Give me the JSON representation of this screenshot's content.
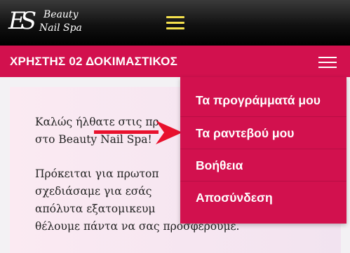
{
  "header": {
    "logo": {
      "mark": "ES",
      "line1": "Beauty",
      "line2": "Nail Spa"
    },
    "menu_icon": "hamburger-icon",
    "menu_icon_color": "#f4e04d"
  },
  "user_bar": {
    "username": "ΧΡΗΣΤΗΣ 02 ΔΟΚΙΜΑΣΤΙΚΟΣ",
    "menu_icon": "hamburger-icon",
    "color": "#d2114e"
  },
  "dropdown": {
    "items": [
      {
        "label": "Τα προγράμματά μου"
      },
      {
        "label": "Τα ραντεβού μου"
      },
      {
        "label": "Βοήθεια"
      },
      {
        "label": "Αποσύνδεση"
      }
    ]
  },
  "content": {
    "paragraph1_lines": [
      "Καλώς ήλθατε στις πρ",
      "στο Beauty Nail Spa!"
    ],
    "paragraph2_lines": [
      "Πρόκειται για πρωτοπ",
      "σχεδιάσαμε για εσάς",
      "απόλυτα εξατομικευμ",
      "θέλουμε πάντα να σας προσφέρουμε."
    ]
  },
  "annotation": {
    "icon": "arrow-right-icon",
    "color": "#e8112d"
  }
}
